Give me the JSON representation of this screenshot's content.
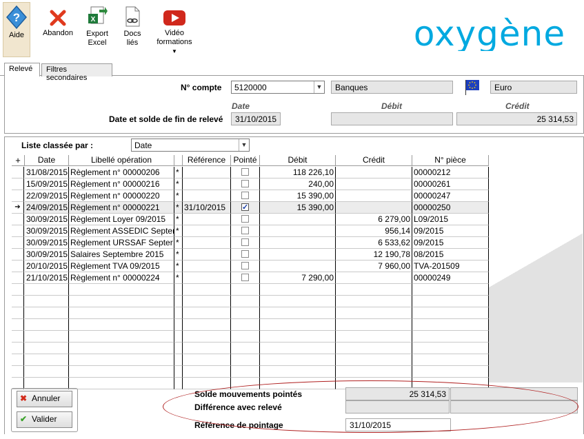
{
  "toolbar": {
    "aide": "Aide",
    "abandon": "Abandon",
    "export_l1": "Export",
    "export_l2": "Excel",
    "docs_l1": "Docs",
    "docs_l2": "liés",
    "video_l1": "Vidéo",
    "video_l2": "formations",
    "logo_text": "oxygène"
  },
  "tabs": [
    "Relevé",
    "Filtres secondaires"
  ],
  "header": {
    "compte_label": "N° compte",
    "compte_value": "5120000",
    "compte_name": "Banques",
    "currency": "Euro",
    "col_date": "Date",
    "col_debit": "Débit",
    "col_credit": "Crédit",
    "solde_label": "Date et solde de fin de relevé",
    "solde_date": "31/10/2015",
    "solde_debit": "",
    "solde_credit": "25 314,53"
  },
  "list": {
    "sort_label": "Liste classée par :",
    "sort_value": "Date"
  },
  "grid": {
    "columns": [
      "Date",
      "Libellé opération",
      "Référence",
      "Pointé",
      "Débit",
      "Crédit",
      "N° pièce"
    ],
    "rows": [
      {
        "date": "31/08/2015",
        "libelle": "Règlement n° 00000206",
        "star": "*",
        "ref": "",
        "pointe": false,
        "debit": "118 226,10",
        "credit": "",
        "piece": "00000212"
      },
      {
        "date": "15/09/2015",
        "libelle": "Règlement n° 00000216",
        "star": "*",
        "ref": "",
        "pointe": false,
        "debit": "240,00",
        "credit": "",
        "piece": "00000261"
      },
      {
        "date": "22/09/2015",
        "libelle": "Règlement n° 00000220",
        "star": "*",
        "ref": "",
        "pointe": false,
        "debit": "15 390,00",
        "credit": "",
        "piece": "00000247"
      },
      {
        "date": "24/09/2015",
        "libelle": "Règlement n° 00000221",
        "star": "*",
        "ref": "31/10/2015",
        "pointe": true,
        "debit": "15 390,00",
        "credit": "",
        "piece": "00000250"
      },
      {
        "date": "30/09/2015",
        "libelle": "Règlement Loyer 09/2015",
        "star": "*",
        "ref": "",
        "pointe": false,
        "debit": "",
        "credit": "6 279,00",
        "piece": "L09/2015"
      },
      {
        "date": "30/09/2015",
        "libelle": "Règlement ASSEDIC Septer",
        "star": "*",
        "ref": "",
        "pointe": false,
        "debit": "",
        "credit": "956,14",
        "piece": "09/2015"
      },
      {
        "date": "30/09/2015",
        "libelle": "Règlement URSSAF Septer",
        "star": "*",
        "ref": "",
        "pointe": false,
        "debit": "",
        "credit": "6 533,62",
        "piece": "09/2015"
      },
      {
        "date": "30/09/2015",
        "libelle": "Salaires Septembre 2015",
        "star": "*",
        "ref": "",
        "pointe": false,
        "debit": "",
        "credit": "12 190,78",
        "piece": "08/2015"
      },
      {
        "date": "20/10/2015",
        "libelle": "Règlement TVA 09/2015",
        "star": "*",
        "ref": "",
        "pointe": false,
        "debit": "",
        "credit": "7 960,00",
        "piece": "TVA-201509"
      },
      {
        "date": "21/10/2015",
        "libelle": "Règlement n° 00000224",
        "star": "*",
        "ref": "",
        "pointe": false,
        "debit": "7 290,00",
        "credit": "",
        "piece": "00000249"
      }
    ],
    "empty_rows": 9
  },
  "footer": {
    "annuler": "Annuler",
    "valider": "Valider",
    "solde_pointes_label": "Solde mouvements pointés",
    "solde_pointes_value": "25 314,53",
    "difference_label": "Différence avec relevé",
    "difference_value": "",
    "reference_label": "Référence de pointage",
    "reference_value": "31/10/2015"
  },
  "colors": {
    "logo": "#00a9e0",
    "abandon": "#e03a1e",
    "video": "#d0281c",
    "ellipse": "#b02020"
  }
}
